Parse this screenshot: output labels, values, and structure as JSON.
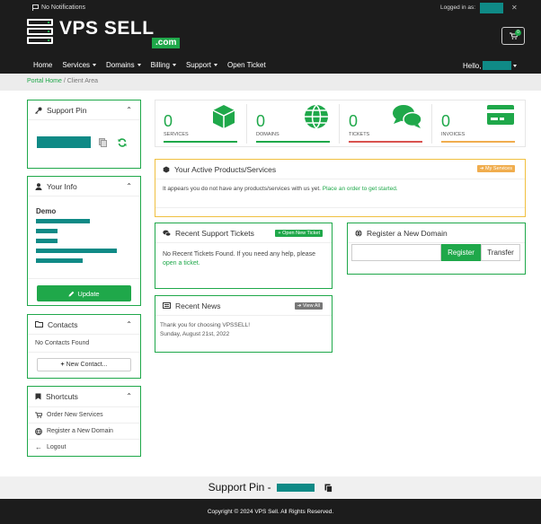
{
  "header": {
    "notifications": "No Notifications",
    "logged_in_as": "Logged in as:",
    "logo_name": "VPS SELL",
    "logo_suffix": ".com",
    "cart_count": "0",
    "nav": [
      {
        "label": "Home"
      },
      {
        "label": "Services"
      },
      {
        "label": "Domains"
      },
      {
        "label": "Billing"
      },
      {
        "label": "Support"
      },
      {
        "label": "Open Ticket"
      }
    ],
    "hello": "Hello,"
  },
  "breadcrumb": {
    "home": "Portal Home",
    "sep": "/",
    "current": "Client Area"
  },
  "support_pin": {
    "title": "Support Pin"
  },
  "your_info": {
    "title": "Your Info",
    "name": "Demo",
    "update_label": "Update"
  },
  "contacts": {
    "title": "Contacts",
    "empty": "No Contacts Found",
    "new_label": "New Contact..."
  },
  "shortcuts": {
    "title": "Shortcuts",
    "items": [
      {
        "label": "Order New Services"
      },
      {
        "label": "Register a New Domain"
      },
      {
        "label": "Logout"
      }
    ]
  },
  "tiles": [
    {
      "value": "0",
      "label": "SERVICES",
      "bar_color": "#1fa84a"
    },
    {
      "value": "0",
      "label": "DOMAINS",
      "bar_color": "#1fa84a"
    },
    {
      "value": "0",
      "label": "TICKETS",
      "bar_color": "#d9534f"
    },
    {
      "value": "0",
      "label": "INVOICES",
      "bar_color": "#f0ad4e"
    }
  ],
  "products": {
    "title": "Your Active Products/Services",
    "badge": "My Services",
    "text": "It appears you do not have any products/services with us yet.",
    "link": "Place an order to get started."
  },
  "tickets": {
    "title": "Recent Support Tickets",
    "badge": "Open New Ticket",
    "text": "No Recent Tickets Found. If you need any help, please",
    "link": "open a ticket."
  },
  "news": {
    "title": "Recent News",
    "badge": "View All",
    "item": "Thank you for choosing VPSSELL!",
    "date": "Sunday, August 21st, 2022"
  },
  "domain": {
    "title": "Register a New Domain",
    "register": "Register",
    "transfer": "Transfer"
  },
  "footer": {
    "pin_label": "Support Pin -",
    "copyright": "Copyright © 2024 VPS Sell. All Rights Reserved."
  },
  "colors": {
    "accent": "#1fa84a",
    "dark": "#1c1c1c",
    "mask": "#0f8a86"
  }
}
